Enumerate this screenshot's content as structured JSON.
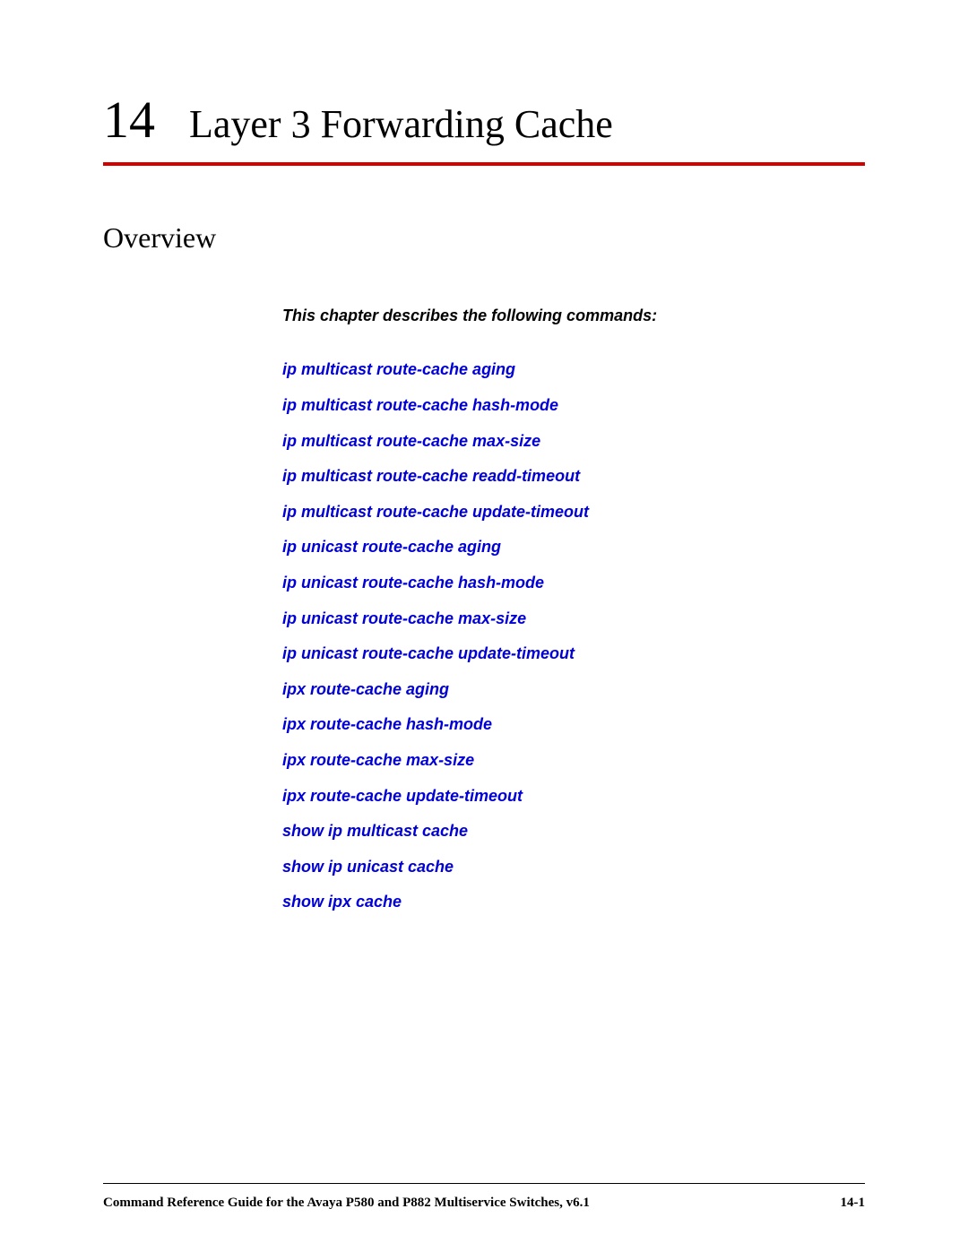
{
  "chapter": {
    "number": "14",
    "title": "Layer 3 Forwarding Cache"
  },
  "section": {
    "title": "Overview"
  },
  "intro": "This chapter describes the following commands:",
  "commands": [
    "ip multicast route-cache aging",
    "ip multicast route-cache hash-mode",
    "ip multicast route-cache max-size",
    "ip multicast route-cache readd-timeout",
    "ip multicast route-cache update-timeout",
    "ip unicast route-cache aging",
    "ip unicast route-cache hash-mode",
    "ip unicast route-cache max-size",
    "ip unicast route-cache update-timeout",
    "ipx route-cache aging",
    "ipx route-cache hash-mode",
    "ipx route-cache max-size",
    "ipx route-cache update-timeout",
    "show ip multicast cache",
    "show ip unicast cache",
    "show ipx cache"
  ],
  "footer": {
    "left": "Command Reference Guide for the Avaya P580 and P882 Multiservice Switches, v6.1",
    "right": "14-1"
  }
}
